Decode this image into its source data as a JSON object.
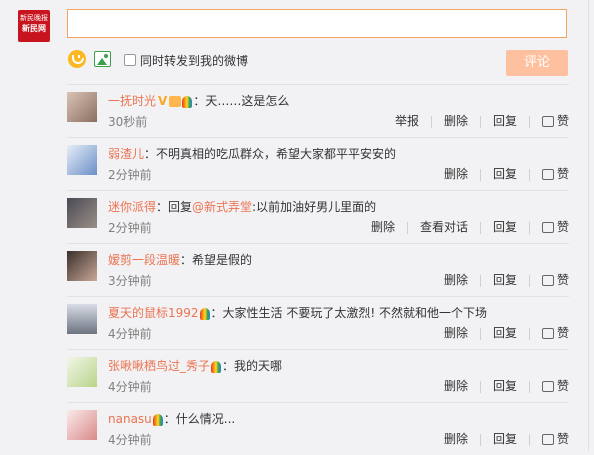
{
  "logo": {
    "line1": "新民晚报",
    "line2": "新民网"
  },
  "composer": {
    "value": "",
    "repost_label": "同时转发到我的微博",
    "submit_label": "评论"
  },
  "colors": {
    "accent": "#eb7350",
    "submit_bg": "#ffc09f",
    "input_border": "#f4a460"
  },
  "comments": [
    {
      "name": "一抚时光",
      "badges": [
        "v-badge",
        "cake-icon",
        "rainbow-icon"
      ],
      "text": "：天……这是怎么",
      "time": "30秒前",
      "actions": [
        "举报",
        "删除",
        "回复",
        "赞"
      ]
    },
    {
      "name": "弱渣儿",
      "badges": [],
      "text": "：不明真相的吃瓜群众，希望大家都平平安安的",
      "time": "2分钟前",
      "actions": [
        "删除",
        "回复",
        "赞"
      ]
    },
    {
      "name": "迷你派得",
      "badges": [],
      "text": "：回复",
      "mention": "@新式弄堂",
      "text2": ":以前加油好男儿里面的",
      "time": "2分钟前",
      "actions": [
        "删除",
        "查看对话",
        "回复",
        "赞"
      ]
    },
    {
      "name": "嫒剪一段温暖",
      "badges": [],
      "text": "：希望是假的",
      "time": "3分钟前",
      "actions": [
        "删除",
        "回复",
        "赞"
      ]
    },
    {
      "name": "夏天的鼠标1992",
      "badges": [
        "rainbow-icon"
      ],
      "text": "：大家性生活 不要玩了太激烈! 不然就和他一个下场",
      "time": "4分钟前",
      "actions": [
        "删除",
        "回复",
        "赞"
      ]
    },
    {
      "name": "张啾啾栖鸟过_秀子",
      "badges": [
        "rainbow-icon"
      ],
      "text": "：我的天哪",
      "time": "4分钟前",
      "actions": [
        "删除",
        "回复",
        "赞"
      ]
    },
    {
      "name": "nanasu",
      "badges": [
        "rainbow-icon"
      ],
      "text": "：什么情况...",
      "time": "4分钟前",
      "actions": [
        "删除",
        "回复",
        "赞"
      ]
    }
  ]
}
